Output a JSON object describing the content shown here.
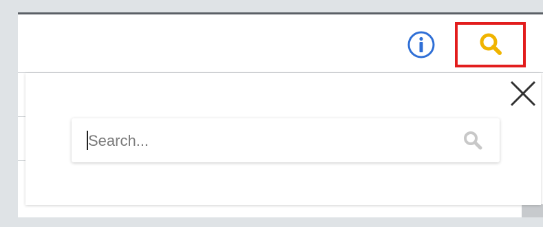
{
  "header": {
    "info_icon": "info-icon",
    "search_icon": "search-icon"
  },
  "popup": {
    "close_icon": "close-icon",
    "search": {
      "placeholder": "Search...",
      "value": "",
      "icon": "search-icon"
    }
  },
  "colors": {
    "info_blue": "#2f6fd6",
    "search_yellow": "#f0b400",
    "highlight_red": "#e21d1d",
    "muted_icon": "#c8c8c8"
  }
}
